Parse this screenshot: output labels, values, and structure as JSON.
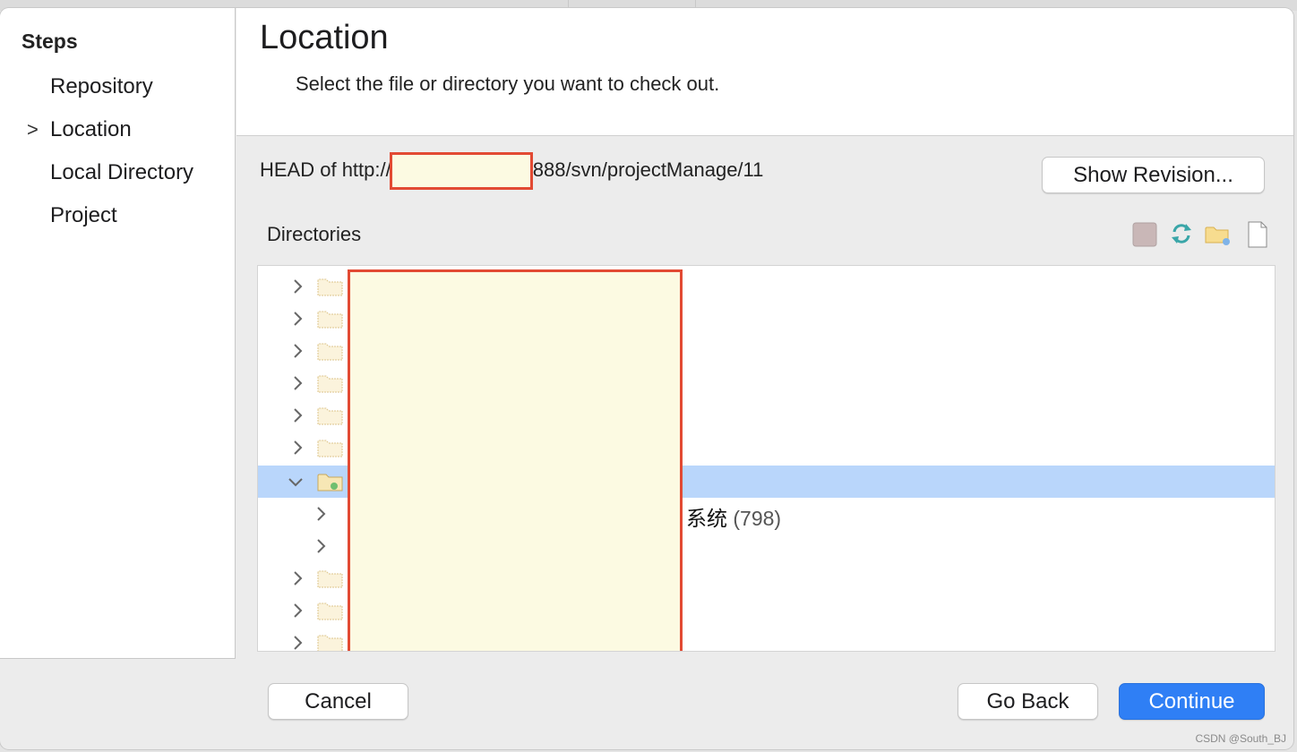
{
  "sidebar": {
    "title": "Steps",
    "items": [
      {
        "label": "Repository",
        "current": false
      },
      {
        "label": "Location",
        "current": true
      },
      {
        "label": "Local Directory",
        "current": false
      },
      {
        "label": "Project",
        "current": false
      }
    ],
    "current_marker": ">"
  },
  "header": {
    "title": "Location",
    "subtitle": "Select the file or directory you want to check out."
  },
  "location": {
    "prefix": "HEAD of http://",
    "suffix": "888/svn/projectManage/11",
    "show_revision_label": "Show Revision..."
  },
  "directories": {
    "label": "Directories",
    "toolbar_icons": [
      "stop-icon",
      "refresh-icon",
      "new-folder-icon",
      "new-file-icon"
    ],
    "visible_row_text": "系统",
    "visible_row_count": "(798)"
  },
  "footer": {
    "cancel_label": "Cancel",
    "go_back_label": "Go Back",
    "continue_label": "Continue"
  },
  "colors": {
    "accent": "#2f7ff5",
    "selection": "#b9d6fb",
    "redaction_fill": "#fcfae2",
    "redaction_border": "#e24a33"
  },
  "watermark": "CSDN @South_BJ"
}
